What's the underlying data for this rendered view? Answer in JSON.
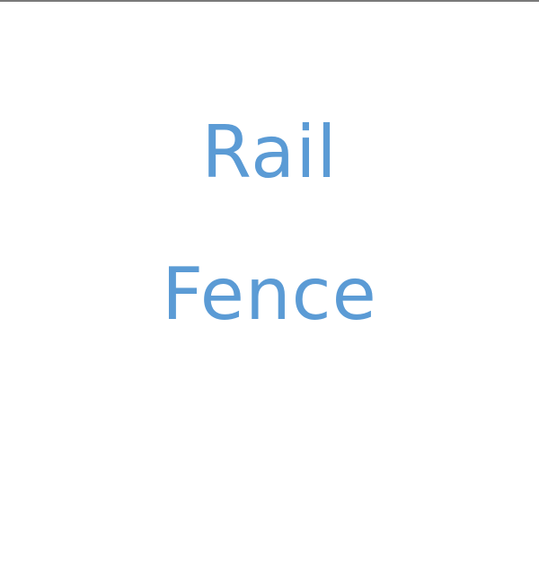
{
  "slide": {
    "title_lines": [
      "Rail",
      "Fence"
    ],
    "text_color": "#5b9bd5",
    "background_color": "#ffffff",
    "top_border_color": "#7a7a7a"
  }
}
